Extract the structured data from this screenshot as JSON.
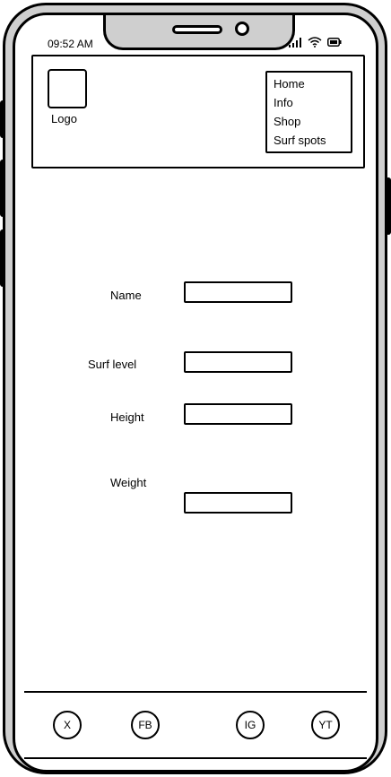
{
  "status_bar": {
    "time": "09:52 AM",
    "icons": [
      "signal-icon",
      "wifi-icon",
      "battery-icon"
    ]
  },
  "header": {
    "logo_label": "Logo",
    "menu": [
      {
        "label": "Home"
      },
      {
        "label": "Info"
      },
      {
        "label": "Shop"
      },
      {
        "label": "Surf spots"
      }
    ]
  },
  "form": {
    "fields": [
      {
        "label": "Name",
        "value": ""
      },
      {
        "label": "Surf level",
        "value": ""
      },
      {
        "label": "Height",
        "value": ""
      },
      {
        "label": "Weight",
        "value": ""
      }
    ]
  },
  "footer": {
    "social": [
      {
        "label": "X"
      },
      {
        "label": "FB"
      },
      {
        "label": "IG"
      },
      {
        "label": "YT"
      }
    ]
  },
  "colors": {
    "frame": "#cfcfcf",
    "ink": "#000000",
    "screen": "#ffffff"
  }
}
